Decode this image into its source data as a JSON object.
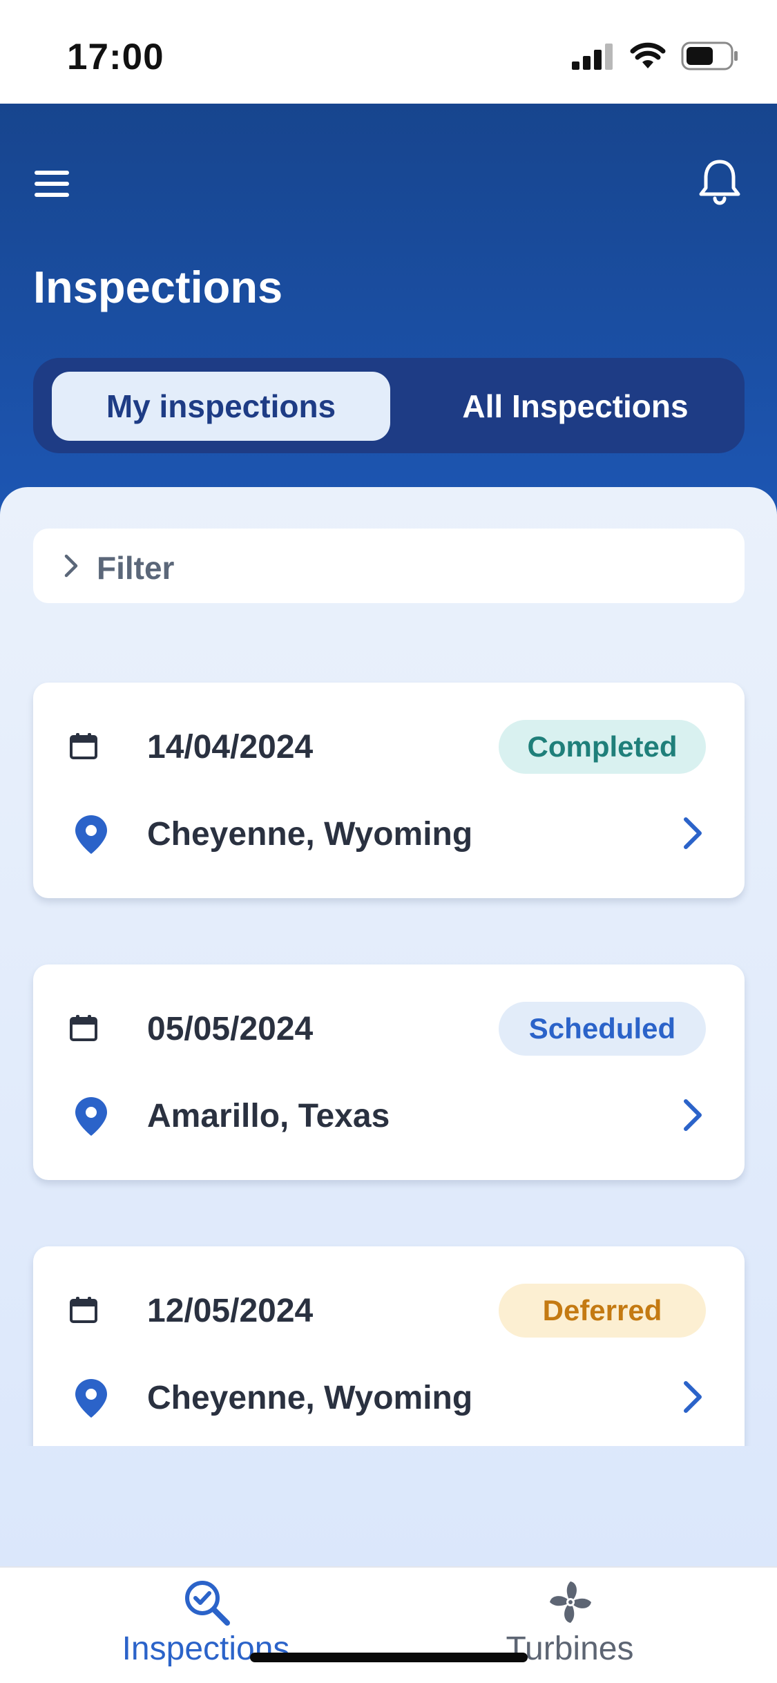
{
  "status_bar": {
    "time": "17:00"
  },
  "header": {
    "title": "Inspections",
    "segments": {
      "active_label": "My inspections",
      "inactive_label": "All Inspections"
    }
  },
  "filter": {
    "label": "Filter"
  },
  "inspections": [
    {
      "date": "14/04/2024",
      "location": "Cheyenne, Wyoming",
      "status": "Completed",
      "status_color": "#1f7f7a",
      "status_bg": "#d9f1f0"
    },
    {
      "date": "05/05/2024",
      "location": "Amarillo, Texas",
      "status": "Scheduled",
      "status_color": "#2b63c9",
      "status_bg": "#e2ecf9"
    },
    {
      "date": "12/05/2024",
      "location": "Cheyenne, Wyoming",
      "status": "Deferred",
      "status_color": "#c47a12",
      "status_bg": "#fcefd2"
    }
  ],
  "tabbar": {
    "tabs": [
      {
        "label": "Inspections",
        "icon": "search-check-icon",
        "active": true,
        "color": "#2b63c9"
      },
      {
        "label": "Turbines",
        "icon": "fan-icon",
        "active": false,
        "color": "#5d6573"
      }
    ]
  },
  "colors": {
    "header_top": "#17458e",
    "header_bottom": "#1d56b3",
    "accent": "#2b63c9",
    "segment_bg": "#1e3c85"
  }
}
